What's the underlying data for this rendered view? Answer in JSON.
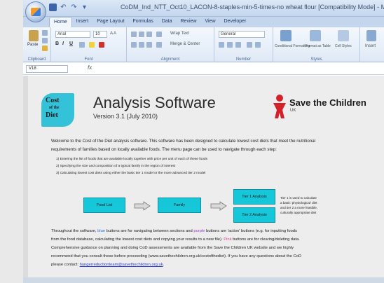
{
  "window": {
    "title": "CoDM_Ind_NTT_Oct10_LACON-8-staples-min-5-times-no wheat flour [Compatibility Mode] - Microsoft E"
  },
  "ribbon": {
    "tabs": [
      "Home",
      "Insert",
      "Page Layout",
      "Formulas",
      "Data",
      "Review",
      "View",
      "Developer"
    ],
    "active_tab": "Home",
    "font_name": "Arial",
    "font_size": "10",
    "wrap_text": "Wrap Text",
    "merge_center": "Merge & Center",
    "number_format": "General",
    "conditional_formatting": "Conditional Formatting",
    "format_as_table": "Format as Table",
    "cell_styles": "Cell Styles",
    "insert": "Insert",
    "paste": "Paste",
    "groups": [
      "Clipboard",
      "Font",
      "Alignment",
      "Number",
      "Styles"
    ]
  },
  "formula_bar": {
    "name_box": "V18",
    "fx": "fx"
  },
  "sheet": {
    "logo": {
      "line1": "Cost",
      "line2": "of the",
      "line3": "Diet"
    },
    "app_title": "Analysis Software",
    "version": "Version 3.1 (July 2010)",
    "org": {
      "name": "Save the Children",
      "country": "UK"
    },
    "welcome_lines": [
      "Welcome to the Cost of the Diet analysis software. This software has been designed to calculate lowest cost diets that meet the nutritional",
      "requirements of families based on locally available foods. The menu page can be used to navigate through each  step:"
    ],
    "steps": [
      "1) Entering the list of foods that are available locally together with price per unit of each of these foods",
      "2) Specifying the size and composition of a typical family in the region of interest",
      "3) Calculating lowest cost diets using either the basic tier 1 model or the more advanced tier 2 model"
    ],
    "buttons": {
      "food_list": "Food List",
      "family": "Family",
      "tier1": "Tier 1 Analysis",
      "tier2": "Tier 2 Analysis"
    },
    "tier_note": [
      "Tier 1 is used to calculate",
      "a basic 'physiological' diet",
      "and tier 2 a more feasible,",
      "culturally appropriate diet"
    ],
    "info": {
      "l1_a": "Throughout the software, ",
      "l1_blue": "blue",
      "l1_b": " buttons are for navigating between sections and ",
      "l1_purple": "purple",
      "l1_c": " buttons are 'action' buttons (e.g. for inputting foods",
      "l2_a": "from the food database, calculating the lowest cost diets and copying your results to a new file). ",
      "l2_pink": "Pink",
      "l2_b": " buttons are for clearing/deleting data.",
      "l3": "Comprehensive guidance on planning and doing CoD assessments are available from the Save the Children UK website and we highly",
      "l4": "recommend that you consult these before proceeding (www.savethechildren.org.uk/costofthediet). If you have any questions about the CoD",
      "l5_a": "please contact: ",
      "l5_email": "hungerreductionteam@savethechildren.org.uk",
      "l5_b": "."
    }
  }
}
